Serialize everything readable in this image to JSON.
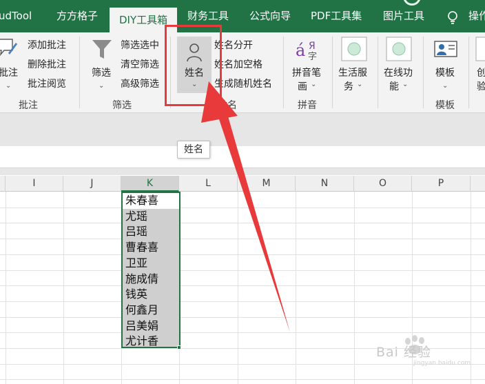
{
  "tabs": [
    {
      "label": "udTool"
    },
    {
      "label": "方方格子"
    },
    {
      "label": "DIY工具箱"
    },
    {
      "label": "财务工具"
    },
    {
      "label": "公式向导"
    },
    {
      "label": "PDF工具集"
    },
    {
      "label": "图片工具"
    },
    {
      "label": "操作"
    }
  ],
  "ribbon": {
    "comment": {
      "big_button": "批注",
      "items": [
        "添加批注",
        "删除批注",
        "批注阅览"
      ],
      "group_label": "批注"
    },
    "filter": {
      "big_button": "筛选",
      "items": [
        "筛选选中",
        "清空筛选",
        "高级筛选"
      ],
      "group_label": "筛选"
    },
    "name": {
      "big_button": "姓名",
      "items": [
        "姓名分开",
        "姓名加空格",
        "生成随机姓名"
      ],
      "group_label": "姓名"
    },
    "pinyin": {
      "big_button_line1": "拼音笔",
      "big_button_line2": "画",
      "group_label": "拼音"
    },
    "life": {
      "line1": "生活服",
      "line2": "务"
    },
    "online": {
      "line1": "在线功",
      "line2": "能"
    },
    "template": {
      "big_button": "模板",
      "group_label": "模板"
    },
    "partial": {
      "line1": "创",
      "line2": "验"
    }
  },
  "tooltip": "姓名",
  "columns": [
    "I",
    "J",
    "K",
    "L",
    "M",
    "N",
    "O",
    "P"
  ],
  "selected_column": "K",
  "names": [
    "朱春喜",
    "尤瑶",
    "吕瑶",
    "曹春喜",
    "卫亚",
    "施成倩",
    "钱英",
    "何鑫月",
    "吕美娟",
    "尤计香"
  ],
  "watermark": {
    "text": "Bai 经验",
    "url": "jingyan.baidu.com"
  },
  "colors": {
    "excel_green": "#217346",
    "highlight_red": "#e83a3a",
    "ribbon_bg": "#f3f3f3"
  }
}
